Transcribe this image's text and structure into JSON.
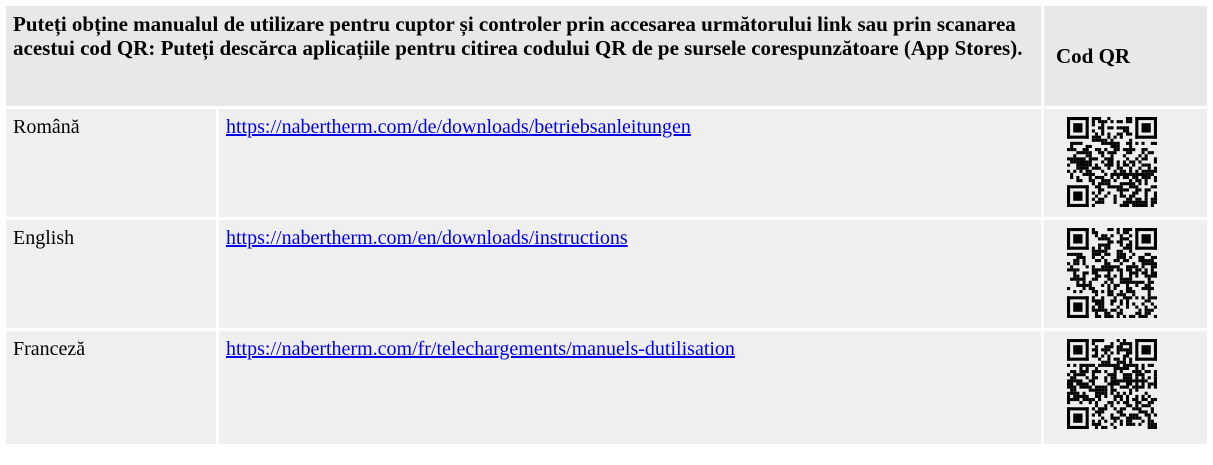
{
  "header": {
    "description": "Puteți obține manualul de utilizare pentru cuptor și controler prin accesarea următorului link sau prin scanarea acestui cod QR: Puteți descărca aplicațiile pentru citirea codului QR de pe sursele corespunzătoare (App Stores).",
    "qr_column_label": "Cod QR"
  },
  "rows": [
    {
      "language": "Română",
      "url": "https://nabertherm.com/de/downloads/betriebsanleitungen",
      "qr_icon": "qr-code-icon"
    },
    {
      "language": "English",
      "url": "https://nabertherm.com/en/downloads/instructions",
      "qr_icon": "qr-code-icon"
    },
    {
      "language": "Franceză",
      "url": "https://nabertherm.com/fr/telechargements/manuels-dutilisation",
      "qr_icon": "qr-code-icon"
    }
  ]
}
